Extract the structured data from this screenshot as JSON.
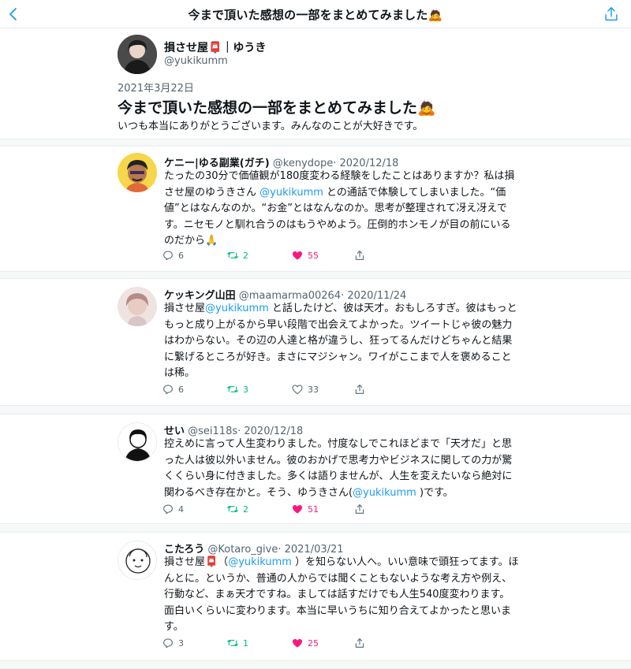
{
  "header": {
    "title": "今まで頂いた感想の一部をまとめてみました🙇",
    "back_icon": "chevron-left-icon",
    "share_icon": "share-upload-icon"
  },
  "moment": {
    "author_name": "損させ屋📮｜ゆうき",
    "author_handle": "@yukikumm",
    "date": "2021年3月22日",
    "title": "今まで頂いた感想の一部をまとめてみました🙇",
    "description": "いつも本当にありがとうございます。みんなのことが大好きです。"
  },
  "tweets": [
    {
      "name": "ケニー|ゆる副業(ガチ)",
      "handle": "@kenydope",
      "date": "· 2020/12/18",
      "body_1": "たったの30分で価値観が180度変わる経験をしたことはありますか？私は損させ屋のゆうきさん ",
      "mention": "@yukikumm",
      "body_2": " との通話で体験してしまいました。“価値”とはなんなのか。“お金”とはなんなのか。思考が整理されて冴え冴えです。ニセモノと馴れ合うのはもうやめよう。圧倒的ホンモノが目の前にいるのだから🙏",
      "replies": "6",
      "retweets": "2",
      "likes": "55",
      "liked": true
    },
    {
      "name": "ケッキング山田",
      "handle": "@maamarma00264",
      "date": "· 2020/11/24",
      "body_1": "損させ屋",
      "mention": "@yukikumm",
      "body_2": " と話したけど、彼は天才。おもしろすぎ。彼はもっともっと成り上がるから早い段階で出会えてよかった。ツイートじゃ彼の魅力はわからない。その辺の人達と格が違うし、狂ってるんだけどちゃんと結果に繋げるところが好き。まさにマジシャン。ワイがここまで人を褒めることは稀。",
      "replies": "6",
      "retweets": "3",
      "likes": "33",
      "liked": false
    },
    {
      "name": "せい",
      "handle": "@sei118s",
      "date": "· 2020/12/18",
      "body_1": "控えめに言って人生変わりました。忖度なしでこれほどまで「天才だ」と思った人は彼以外いません。彼のおかげで思考力やビジネスに関しての力が驚くくらい身に付きました。多くは語りませんが、人生を変えたいなら絶対に関わるべき存在かと。そう、ゆうきさん(",
      "mention": "@yukikumm",
      "body_2": " )です。",
      "replies": "4",
      "retweets": "2",
      "likes": "51",
      "liked": true
    },
    {
      "name": "こたろう",
      "handle": "@Kotaro_give",
      "date": "· 2021/03/21",
      "body_1": "損させ屋📮（",
      "mention": "@yukikumm",
      "body_2": " ）を知らない人へ。いい意味で頭狂ってます。ほんとに。というか、普通の人からでは聞くこともないような考え方や例え、行動など、まぁ天才ですね。ましては話すだけでも人生540度変わります。面白いくらいに変わります。本当に早いうちに知り合えてよかったと思います。",
      "replies": "3",
      "retweets": "1",
      "likes": "25",
      "liked": true
    }
  ],
  "colors": {
    "accent": "#1d9bf0",
    "retweet": "#00ba7c",
    "like": "#f91880",
    "muted": "#536471"
  }
}
